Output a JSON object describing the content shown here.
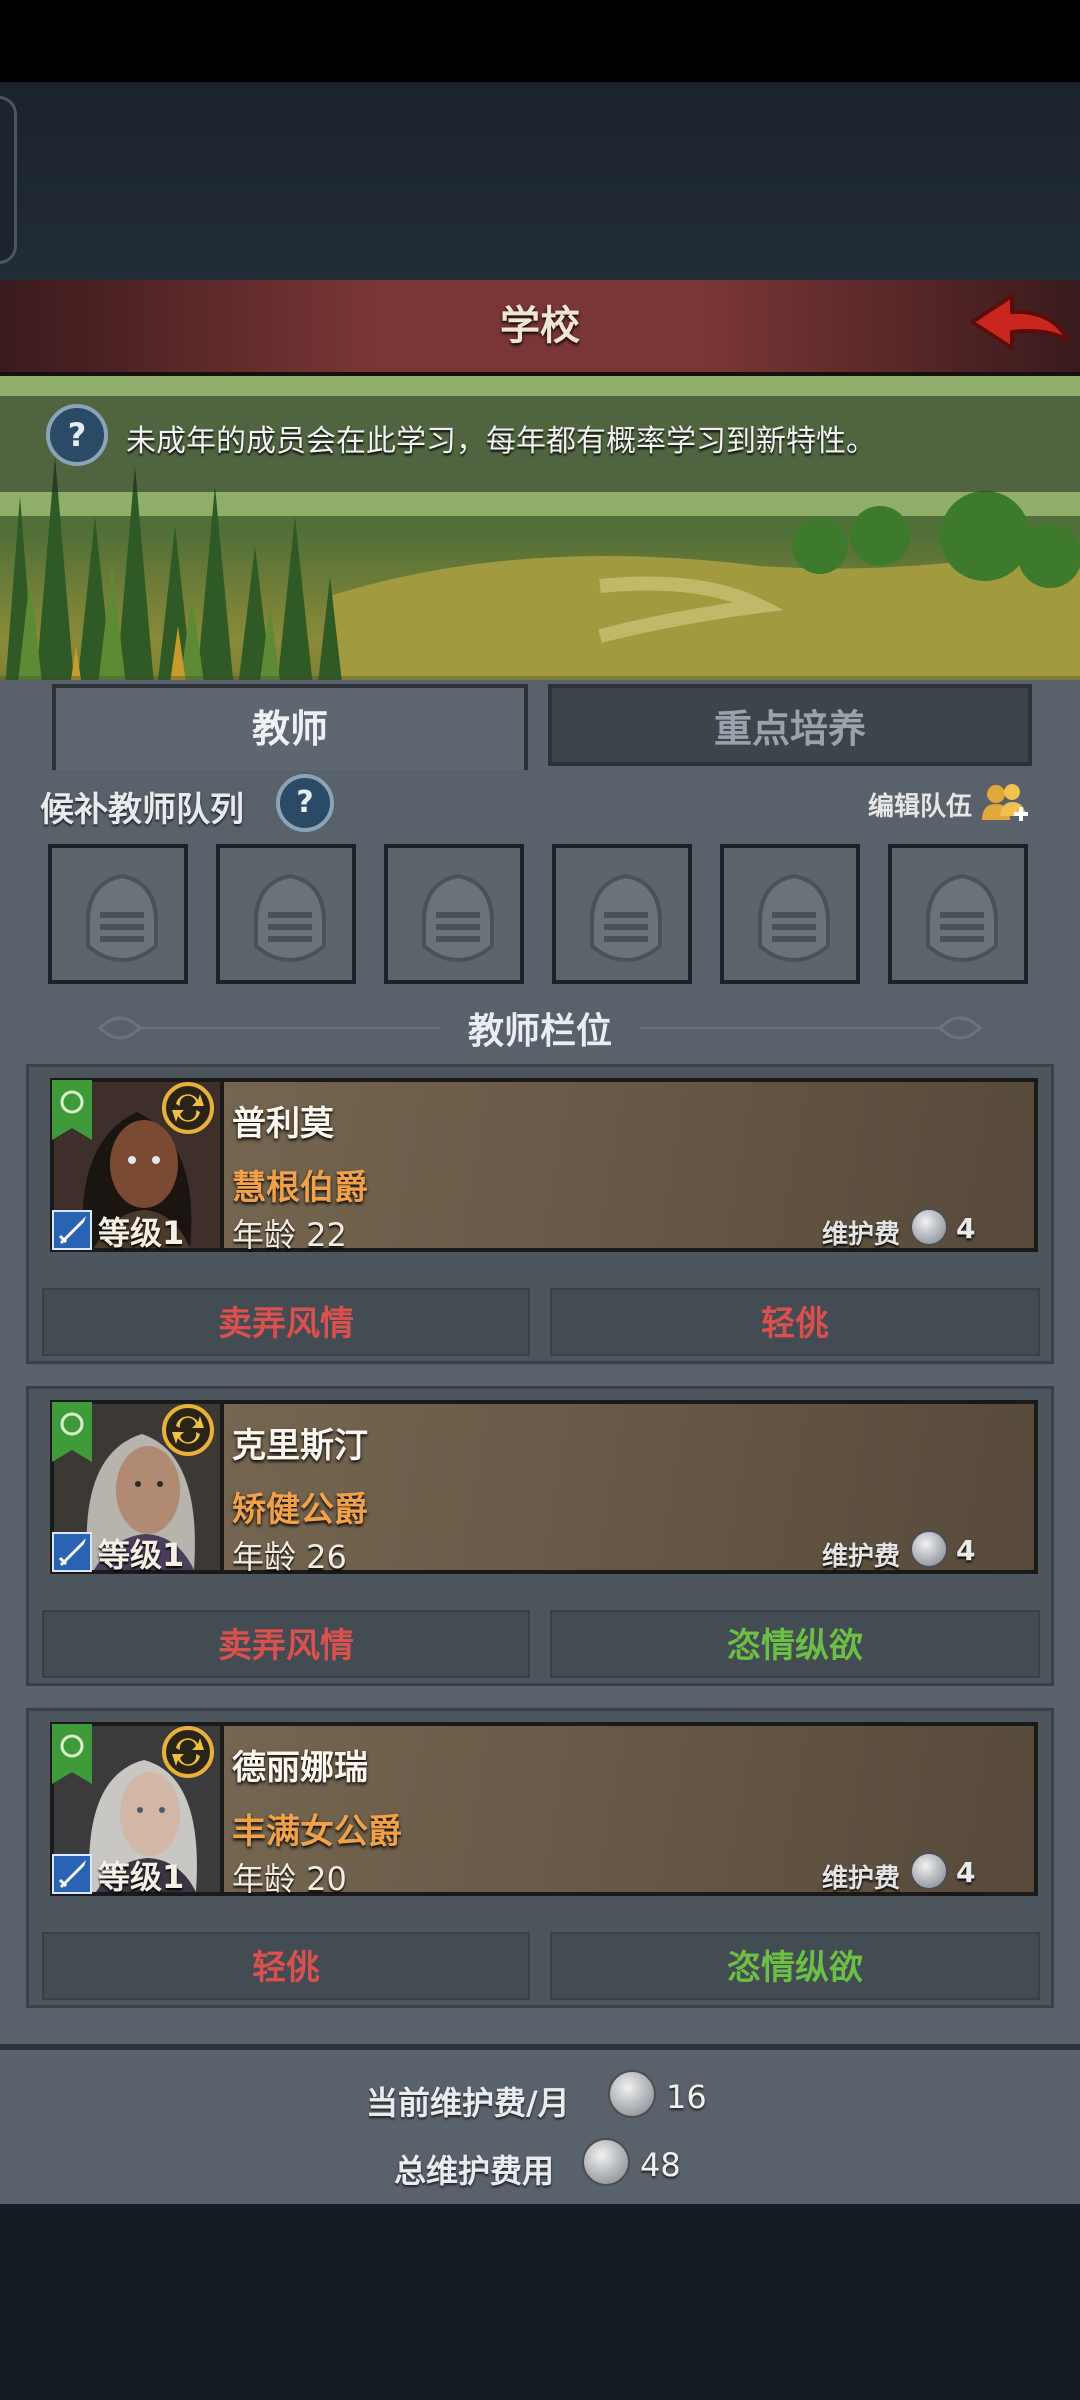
{
  "header": {
    "title": "学校",
    "back_icon": "back-arrow-icon"
  },
  "banner": {
    "info_text": "未成年的成员会在此学习，每年都有概率学习到新特性。",
    "help_symbol": "?"
  },
  "tabs": [
    {
      "label": "教师",
      "active": true
    },
    {
      "label": "重点培养",
      "active": false
    }
  ],
  "reserve": {
    "label": "候补教师队列",
    "help_symbol": "?",
    "edit_team_label": "编辑队伍",
    "empty_slot_icon": "knight-helmet-icon",
    "slot_count": 6
  },
  "slot_section_title": "教师栏位",
  "teachers": [
    {
      "name": "普利莫",
      "rank": "慧根伯爵",
      "level": "等级1",
      "age": "年龄 22",
      "upkeep_label": "维护费",
      "upkeep_value": "4",
      "traits": [
        {
          "label": "卖弄风情",
          "color": "#d9504c"
        },
        {
          "label": "轻佻",
          "color": "#d9504c"
        }
      ],
      "portrait_colors": {
        "bg": "#3e2f2a",
        "skin": "#7a4a32",
        "hair": "#1b1512"
      }
    },
    {
      "name": "克里斯汀",
      "rank": "矫健公爵",
      "level": "等级1",
      "age": "年龄 26",
      "upkeep_label": "维护费",
      "upkeep_value": "4",
      "traits": [
        {
          "label": "卖弄风情",
          "color": "#d9504c"
        },
        {
          "label": "恣情纵欲",
          "color": "#6bbf45"
        }
      ],
      "portrait_colors": {
        "bg": "#3c3834",
        "skin": "#b08a72",
        "hair": "#b7b3ad"
      }
    },
    {
      "name": "德丽娜瑞",
      "rank": "丰满女公爵",
      "level": "等级1",
      "age": "年龄 20",
      "upkeep_label": "维护费",
      "upkeep_value": "4",
      "traits": [
        {
          "label": "轻佻",
          "color": "#d9504c"
        },
        {
          "label": "恣情纵欲",
          "color": "#6bbf45"
        }
      ],
      "portrait_colors": {
        "bg": "#3b3a3c",
        "skin": "#d2b6a6",
        "hair": "#c9c7c3"
      }
    }
  ],
  "footer": {
    "monthly_label": "当前维护费/月",
    "monthly_value": "16",
    "total_label": "总维护费用",
    "total_value": "48"
  }
}
